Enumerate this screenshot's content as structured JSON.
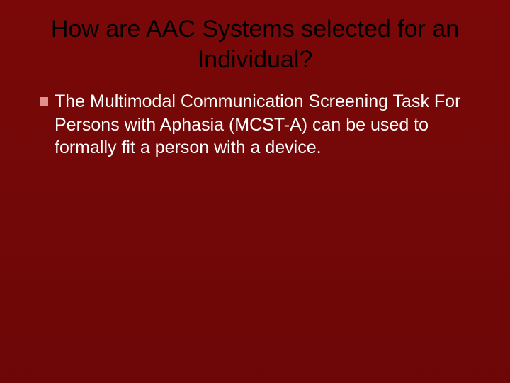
{
  "slide": {
    "title": "How are AAC Systems selected for an Individual?",
    "bullet_text": "The Multimodal Communication Screening Task For Persons with Aphasia (MCST-A) can be used to formally fit a person with a device."
  }
}
